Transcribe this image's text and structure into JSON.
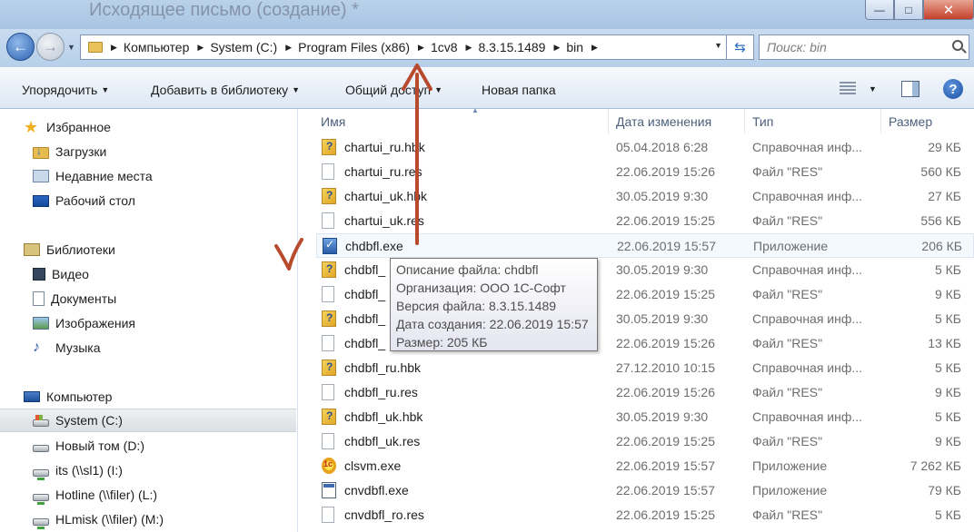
{
  "window": {
    "title": "Исходящее письмо (создание) *",
    "minimize": "—",
    "maximize": "□",
    "close": "✕"
  },
  "address": {
    "crumbs": [
      "Компьютер",
      "System (C:)",
      "Program Files (x86)",
      "1cv8",
      "8.3.15.1489",
      "bin"
    ],
    "search_placeholder": "Поиск: bin"
  },
  "toolbar": {
    "organize": "Упорядочить",
    "add_library": "Добавить в библиотеку",
    "share": "Общий доступ",
    "new_folder": "Новая папка"
  },
  "sidebar": {
    "favorites": {
      "label": "Избранное",
      "items": [
        "Загрузки",
        "Недавние места",
        "Рабочий стол"
      ]
    },
    "libraries": {
      "label": "Библиотеки",
      "items": [
        "Видео",
        "Документы",
        "Изображения",
        "Музыка"
      ]
    },
    "computer": {
      "label": "Компьютер",
      "items": [
        "System (C:)",
        "Новый том (D:)",
        "its (\\\\sl1) (I:)",
        "Hotline (\\\\filer) (L:)",
        "HLmisk (\\\\filer) (M:)"
      ]
    }
  },
  "columns": {
    "name": "Имя",
    "date": "Дата изменения",
    "type": "Тип",
    "size": "Размер"
  },
  "files": [
    {
      "name": "chartui_ru.hbk",
      "date": "05.04.2018 6:28",
      "type": "Справочная инф...",
      "size": "29 КБ",
      "icon": "help-file-icon"
    },
    {
      "name": "chartui_ru.res",
      "date": "22.06.2019 15:26",
      "type": "Файл \"RES\"",
      "size": "560 КБ",
      "icon": "file-icon"
    },
    {
      "name": "chartui_uk.hbk",
      "date": "30.05.2019 9:30",
      "type": "Справочная инф...",
      "size": "27 КБ",
      "icon": "help-file-icon"
    },
    {
      "name": "chartui_uk.res",
      "date": "22.06.2019 15:25",
      "type": "Файл \"RES\"",
      "size": "556 КБ",
      "icon": "file-icon"
    },
    {
      "name": "chdbfl.exe",
      "date": "22.06.2019 15:57",
      "type": "Приложение",
      "size": "206 КБ",
      "icon": "exe-icon"
    },
    {
      "name": "chdbfl_",
      "date": "30.05.2019 9:30",
      "type": "Справочная инф...",
      "size": "5 КБ",
      "icon": "help-file-icon"
    },
    {
      "name": "chdbfl_",
      "date": "22.06.2019 15:25",
      "type": "Файл \"RES\"",
      "size": "9 КБ",
      "icon": "file-icon"
    },
    {
      "name": "chdbfl_",
      "date": "30.05.2019 9:30",
      "type": "Справочная инф...",
      "size": "5 КБ",
      "icon": "help-file-icon"
    },
    {
      "name": "chdbfl_",
      "date": "22.06.2019 15:26",
      "type": "Файл \"RES\"",
      "size": "13 КБ",
      "icon": "file-icon"
    },
    {
      "name": "chdbfl_ru.hbk",
      "date": "27.12.2010 10:15",
      "type": "Справочная инф...",
      "size": "5 КБ",
      "icon": "help-file-icon"
    },
    {
      "name": "chdbfl_ru.res",
      "date": "22.06.2019 15:26",
      "type": "Файл \"RES\"",
      "size": "9 КБ",
      "icon": "file-icon"
    },
    {
      "name": "chdbfl_uk.hbk",
      "date": "30.05.2019 9:30",
      "type": "Справочная инф...",
      "size": "5 КБ",
      "icon": "help-file-icon"
    },
    {
      "name": "chdbfl_uk.res",
      "date": "22.06.2019 15:25",
      "type": "Файл \"RES\"",
      "size": "9 КБ",
      "icon": "file-icon"
    },
    {
      "name": "clsvm.exe",
      "date": "22.06.2019 15:57",
      "type": "Приложение",
      "size": "7 262 КБ",
      "icon": "1c-app-icon"
    },
    {
      "name": "cnvdbfl.exe",
      "date": "22.06.2019 15:57",
      "type": "Приложение",
      "size": "79 КБ",
      "icon": "app-icon"
    },
    {
      "name": "cnvdbfl_ro.res",
      "date": "22.06.2019 15:25",
      "type": "Файл \"RES\"",
      "size": "5 КБ",
      "icon": "file-icon"
    }
  ],
  "tooltip": {
    "line1": "Описание файла: chdbfl",
    "line2": "Организация: ООО 1С-Софт",
    "line3": "Версия файла: 8.3.15.1489",
    "line4": "Дата создания: 22.06.2019 15:57",
    "line5": "Размер: 205 КБ"
  },
  "annotation": {
    "color": "#b84a2e"
  }
}
